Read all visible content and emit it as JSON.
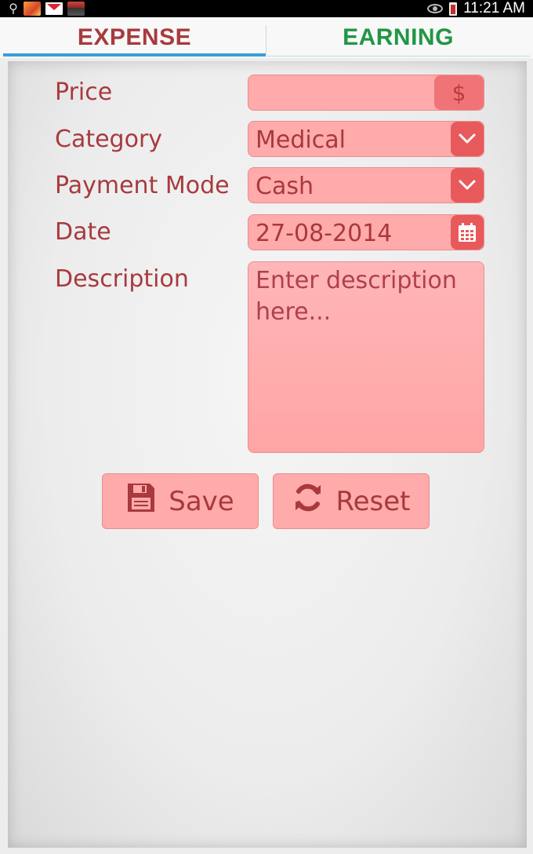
{
  "status_bar": {
    "time": "11:21 AM",
    "left_icons": [
      "usb-icon",
      "app-notification-icon",
      "gmail-icon",
      "app-notification-icon"
    ],
    "right_icons": [
      "eye-icon",
      "battery-charging-icon"
    ]
  },
  "tabs": [
    {
      "label": "EXPENSE",
      "active": true,
      "color": "#a83a3e"
    },
    {
      "label": "EARNING",
      "active": false,
      "color": "#219645"
    }
  ],
  "form": {
    "price": {
      "label": "Price",
      "value": "",
      "addon": "$"
    },
    "category": {
      "label": "Category",
      "value": "Medical",
      "addon_icon": "chevron-down-icon"
    },
    "payment_mode": {
      "label": "Payment Mode",
      "value": "Cash",
      "addon_icon": "chevron-down-icon"
    },
    "date": {
      "label": "Date",
      "value": "27-08-2014",
      "addon_icon": "calendar-icon"
    },
    "description": {
      "label": "Description",
      "placeholder": "Enter description here..."
    }
  },
  "buttons": {
    "save": {
      "label": "Save",
      "icon": "floppy-disk-icon"
    },
    "reset": {
      "label": "Reset",
      "icon": "refresh-icon"
    }
  },
  "colors": {
    "accent": "#a83a3e",
    "field_bg": "#ffaaab",
    "addon_bg": "#e8595c",
    "tab_indicator": "#3a9ed8"
  }
}
